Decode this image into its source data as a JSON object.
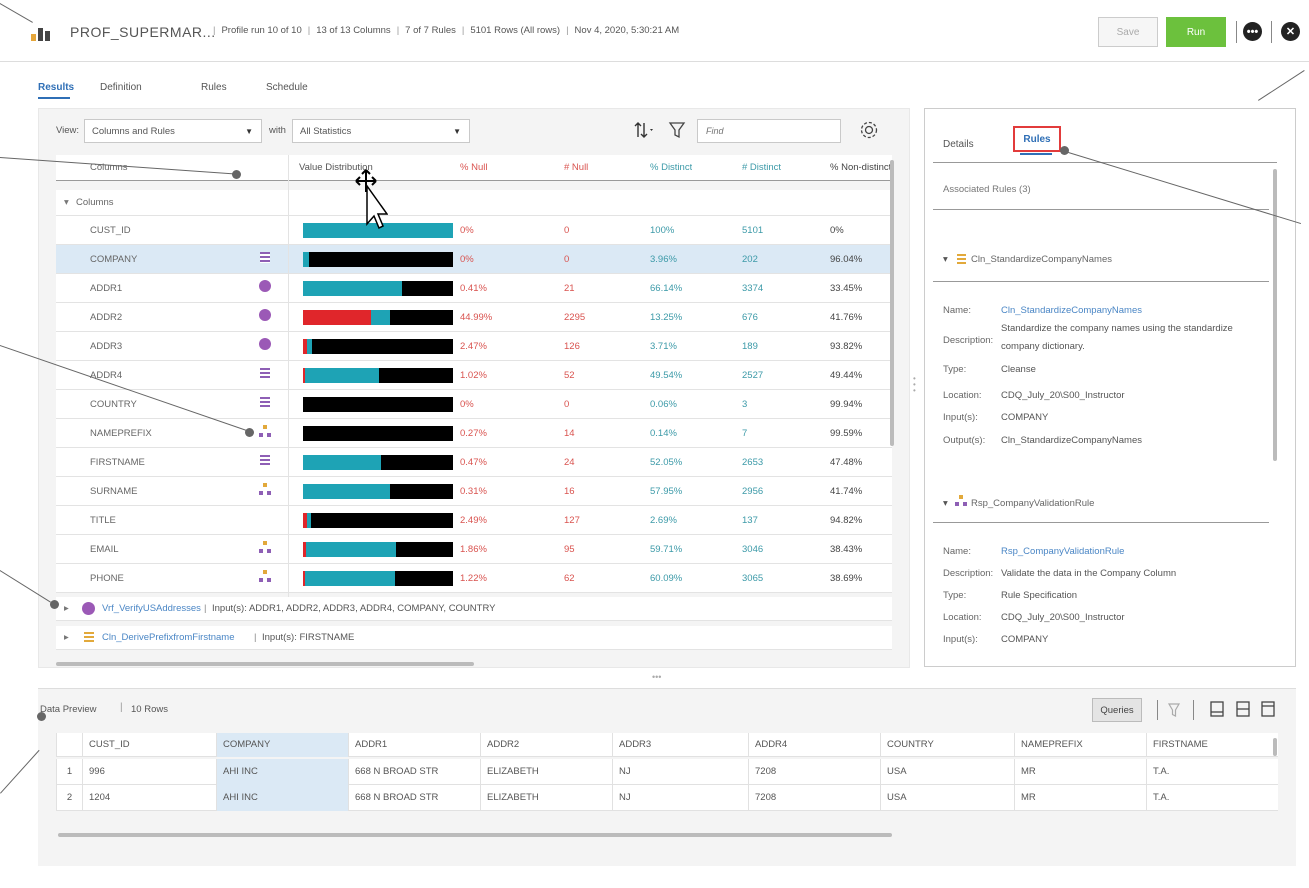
{
  "header": {
    "title": "PROF_SUPERMAR...",
    "meta": [
      "Profile run 10 of 10",
      "13 of 13 Columns",
      "7 of 7 Rules",
      "5101 Rows (All rows)",
      "Nov 4, 2020, 5:30:21 AM"
    ],
    "save_label": "Save",
    "run_label": "Run"
  },
  "tabs": [
    "Results",
    "Definition",
    "Rules",
    "Schedule"
  ],
  "toolbar": {
    "view_label": "View:",
    "view_value": "Columns and Rules",
    "with_label": "with",
    "with_value": "All Statistics",
    "find_placeholder": "Find"
  },
  "grid": {
    "headers": [
      "Columns",
      "Value Distribution",
      "% Null",
      "# Null",
      "% Distinct",
      "# Distinct",
      "% Non-distinct"
    ],
    "group_label": "Columns",
    "rows": [
      {
        "name": "CUST_ID",
        "icon": "",
        "pnull": "0%",
        "nnull": "0",
        "pdist": "100%",
        "ndist": "5101",
        "pnond": "0%",
        "dist": [
          {
            "c": "#1ea3b5",
            "w": 100
          }
        ]
      },
      {
        "name": "COMPANY",
        "icon": "cleanse",
        "pnull": "0%",
        "nnull": "0",
        "pdist": "3.96%",
        "ndist": "202",
        "pnond": "96.04%",
        "dist": [
          {
            "c": "#1ea3b5",
            "w": 4
          },
          {
            "c": "#000000",
            "w": 96
          }
        ]
      },
      {
        "name": "ADDR1",
        "icon": "verify",
        "pnull": "0.41%",
        "nnull": "21",
        "pdist": "66.14%",
        "ndist": "3374",
        "pnond": "33.45%",
        "dist": [
          {
            "c": "#1ea3b5",
            "w": 66
          },
          {
            "c": "#000000",
            "w": 34
          }
        ]
      },
      {
        "name": "ADDR2",
        "icon": "verify",
        "pnull": "44.99%",
        "nnull": "2295",
        "pdist": "13.25%",
        "ndist": "676",
        "pnond": "41.76%",
        "dist": [
          {
            "c": "#e0262b",
            "w": 45
          },
          {
            "c": "#1ea3b5",
            "w": 13
          },
          {
            "c": "#000000",
            "w": 42
          }
        ]
      },
      {
        "name": "ADDR3",
        "icon": "verify",
        "pnull": "2.47%",
        "nnull": "126",
        "pdist": "3.71%",
        "ndist": "189",
        "pnond": "93.82%",
        "dist": [
          {
            "c": "#e0262b",
            "w": 2.5
          },
          {
            "c": "#1ea3b5",
            "w": 3.7
          },
          {
            "c": "#000000",
            "w": 93.8
          }
        ]
      },
      {
        "name": "ADDR4",
        "icon": "cleanse",
        "pnull": "1.02%",
        "nnull": "52",
        "pdist": "49.54%",
        "ndist": "2527",
        "pnond": "49.44%",
        "dist": [
          {
            "c": "#e0262b",
            "w": 1
          },
          {
            "c": "#1ea3b5",
            "w": 49.5
          },
          {
            "c": "#000000",
            "w": 49.5
          }
        ]
      },
      {
        "name": "COUNTRY",
        "icon": "cleanse",
        "pnull": "0%",
        "nnull": "0",
        "pdist": "0.06%",
        "ndist": "3",
        "pnond": "99.94%",
        "dist": [
          {
            "c": "#000000",
            "w": 100
          }
        ]
      },
      {
        "name": "NAMEPREFIX",
        "icon": "validate",
        "pnull": "0.27%",
        "nnull": "14",
        "pdist": "0.14%",
        "ndist": "7",
        "pnond": "99.59%",
        "dist": [
          {
            "c": "#000000",
            "w": 100
          }
        ]
      },
      {
        "name": "FIRSTNAME",
        "icon": "cleanse",
        "pnull": "0.47%",
        "nnull": "24",
        "pdist": "52.05%",
        "ndist": "2653",
        "pnond": "47.48%",
        "dist": [
          {
            "c": "#1ea3b5",
            "w": 52
          },
          {
            "c": "#000000",
            "w": 48
          }
        ]
      },
      {
        "name": "SURNAME",
        "icon": "validate",
        "pnull": "0.31%",
        "nnull": "16",
        "pdist": "57.95%",
        "ndist": "2956",
        "pnond": "41.74%",
        "dist": [
          {
            "c": "#1ea3b5",
            "w": 58
          },
          {
            "c": "#000000",
            "w": 42
          }
        ]
      },
      {
        "name": "TITLE",
        "icon": "",
        "pnull": "2.49%",
        "nnull": "127",
        "pdist": "2.69%",
        "ndist": "137",
        "pnond": "94.82%",
        "dist": [
          {
            "c": "#e0262b",
            "w": 2.5
          },
          {
            "c": "#1ea3b5",
            "w": 2.7
          },
          {
            "c": "#000000",
            "w": 94.8
          }
        ]
      },
      {
        "name": "EMAIL",
        "icon": "validate",
        "pnull": "1.86%",
        "nnull": "95",
        "pdist": "59.71%",
        "ndist": "3046",
        "pnond": "38.43%",
        "dist": [
          {
            "c": "#e0262b",
            "w": 2
          },
          {
            "c": "#1ea3b5",
            "w": 60
          },
          {
            "c": "#000000",
            "w": 38
          }
        ]
      },
      {
        "name": "PHONE",
        "icon": "validate",
        "pnull": "1.22%",
        "nnull": "62",
        "pdist": "60.09%",
        "ndist": "3065",
        "pnond": "38.69%",
        "dist": [
          {
            "c": "#e0262b",
            "w": 1
          },
          {
            "c": "#1ea3b5",
            "w": 60
          },
          {
            "c": "#000000",
            "w": 39
          }
        ]
      }
    ],
    "rules": [
      {
        "name": "Vrf_VerifyUSAddresses",
        "inputs": "Input(s): ADDR1, ADDR2, ADDR3, ADDR4, COMPANY, COUNTRY",
        "icon": "verify"
      },
      {
        "name": "Cln_DerivePrefixfromFirstname",
        "inputs": "Input(s): FIRSTNAME",
        "icon": "cleanse"
      }
    ]
  },
  "details": {
    "tabs": [
      "Details",
      "Rules"
    ],
    "associated": "Associated Rules (3)",
    "labels": {
      "name": "Name:",
      "desc": "Description:",
      "type": "Type:",
      "loc": "Location:",
      "in": "Input(s):",
      "out": "Output(s):"
    },
    "rule1": {
      "title": "Cln_StandardizeCompanyNames",
      "name": "Cln_StandardizeCompanyNames",
      "desc1": "Standardize the company names using the standardize",
      "desc2": "company dictionary.",
      "type": "Cleanse",
      "location": "CDQ_July_20\\S00_Instructor",
      "inputs": "COMPANY",
      "outputs": "Cln_StandardizeCompanyNames"
    },
    "rule2": {
      "title": "Rsp_CompanyValidationRule",
      "name": "Rsp_CompanyValidationRule",
      "desc": "Validate the data in the Company Column",
      "type": "Rule Specification",
      "location": "CDQ_July_20\\S00_Instructor",
      "inputs": "COMPANY"
    }
  },
  "preview": {
    "label": "Data Preview",
    "rows_label": "10 Rows",
    "queries_label": "Queries",
    "columns": [
      "CUST_ID",
      "COMPANY",
      "ADDR1",
      "ADDR2",
      "ADDR3",
      "ADDR4",
      "COUNTRY",
      "NAMEPREFIX",
      "FIRSTNAME"
    ],
    "rows": [
      [
        "1",
        "996",
        "AHI INC",
        "668 N BROAD STR",
        "ELIZABETH",
        "NJ",
        "7208",
        "USA",
        "MR",
        "T.A."
      ],
      [
        "2",
        "1204",
        "AHI INC",
        "668 N BROAD STR",
        "ELIZABETH",
        "NJ",
        "7208",
        "USA",
        "MR",
        "T.A."
      ]
    ]
  },
  "colors": {
    "accent": "#2f6fb6",
    "run": "#6cc13d",
    "teal": "#1ea3b5",
    "red": "#e0262b",
    "null_text": "#d9534f",
    "distinct_text": "#3c9aa8"
  }
}
